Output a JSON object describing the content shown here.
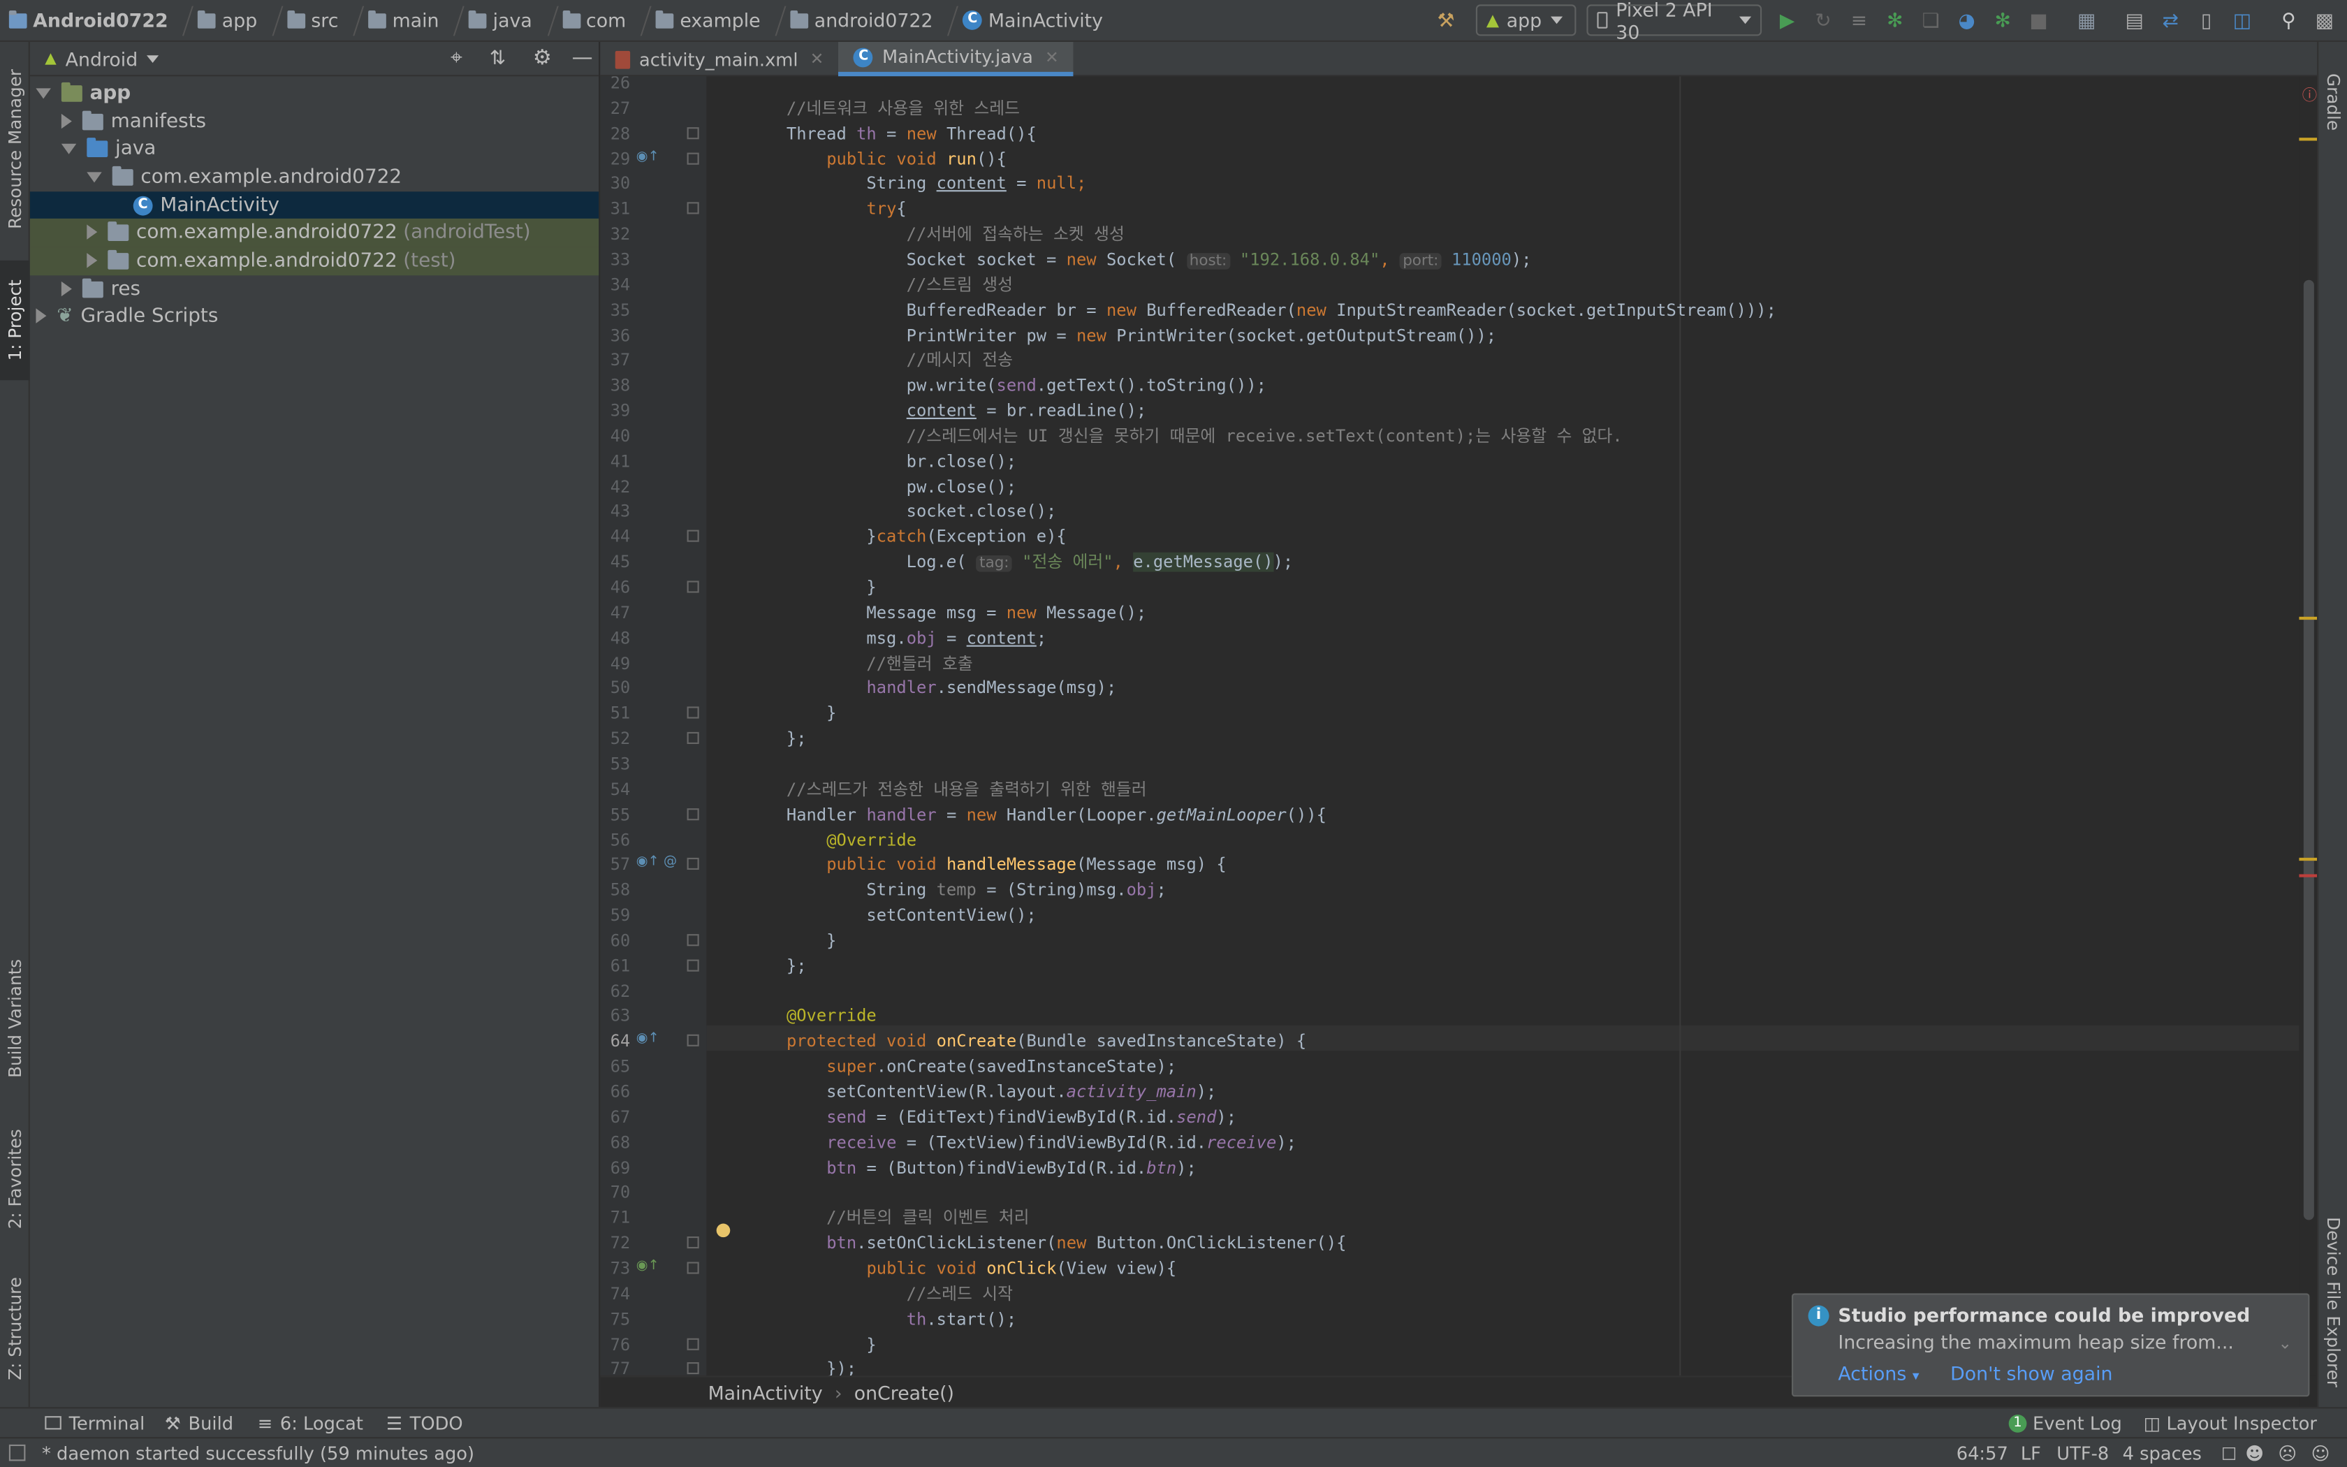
{
  "breadcrumb": {
    "items": [
      "Android0722",
      "app",
      "src",
      "main",
      "java",
      "com",
      "example",
      "android0722"
    ],
    "file": "MainActivity"
  },
  "toolbar": {
    "config": "app",
    "device": "Pixel 2 API 30"
  },
  "left_stripe": {
    "tabs": [
      "Resource Manager",
      "1: Project",
      "Build Variants",
      "2: Favorites",
      "Z: Structure"
    ]
  },
  "right_stripe": {
    "tabs": [
      "Gradle",
      "Device File Explorer"
    ]
  },
  "project_panel": {
    "view": "Android",
    "tree": [
      {
        "label": "app",
        "extra": ""
      },
      {
        "label": "manifests",
        "extra": ""
      },
      {
        "label": "java",
        "extra": ""
      },
      {
        "label": "com.example.android0722",
        "extra": ""
      },
      {
        "label": "MainActivity",
        "extra": ""
      },
      {
        "label": "com.example.android0722",
        "extra": "(androidTest)"
      },
      {
        "label": "com.example.android0722",
        "extra": "(test)"
      },
      {
        "label": "res",
        "extra": ""
      },
      {
        "label": "Gradle Scripts",
        "extra": ""
      }
    ]
  },
  "editor": {
    "tabs": [
      "activity_main.xml",
      "MainActivity.java"
    ],
    "line_numbers": [
      "26",
      "27",
      "28",
      "29",
      "30",
      "31",
      "32",
      "33",
      "34",
      "35",
      "36",
      "37",
      "38",
      "39",
      "40",
      "41",
      "42",
      "43",
      "44",
      "45",
      "46",
      "47",
      "48",
      "49",
      "50",
      "51",
      "52",
      "53",
      "54",
      "55",
      "56",
      "57",
      "58",
      "59",
      "60",
      "61",
      "62",
      "63",
      "64",
      "65",
      "66",
      "67",
      "68",
      "69",
      "70",
      "71",
      "72",
      "73",
      "74",
      "75",
      "76",
      "77"
    ],
    "lines": [
      [],
      [
        {
          "t": "        //네트워크 사용을 위한 스레드",
          "c": "cm"
        }
      ],
      [
        {
          "t": "        Thread "
        },
        {
          "t": "th",
          "c": "fld"
        },
        {
          "t": " = "
        },
        {
          "t": "new",
          "c": "kw"
        },
        {
          "t": " Thread(){"
        }
      ],
      [
        {
          "t": "            "
        },
        {
          "t": "public void",
          "c": "kw"
        },
        {
          "t": " "
        },
        {
          "t": "run",
          "c": "mth"
        },
        {
          "t": "(){"
        }
      ],
      [
        {
          "t": "                String "
        },
        {
          "t": "content",
          "c": "ul"
        },
        {
          "t": " = "
        },
        {
          "t": "null",
          "c": "kw"
        },
        {
          "t": ";",
          "c": "kw"
        }
      ],
      [
        {
          "t": "                "
        },
        {
          "t": "try",
          "c": "kw"
        },
        {
          "t": "{"
        }
      ],
      [
        {
          "t": "                    //서버에 접속하는 소켓 생성",
          "c": "cm"
        }
      ],
      [
        {
          "t": "                    Socket socket = "
        },
        {
          "t": "new",
          "c": "kw"
        },
        {
          "t": " Socket( "
        },
        {
          "t": "host:",
          "c": "hint"
        },
        {
          "t": " "
        },
        {
          "t": "\"192.168.0.84\"",
          "c": "str"
        },
        {
          "t": ", ",
          "c": "kw"
        },
        {
          "t": "port:",
          "c": "hint"
        },
        {
          "t": " "
        },
        {
          "t": "110000",
          "c": "num"
        },
        {
          "t": ");"
        }
      ],
      [
        {
          "t": "                    //스트림 생성",
          "c": "cm"
        }
      ],
      [
        {
          "t": "                    BufferedReader br = "
        },
        {
          "t": "new",
          "c": "kw"
        },
        {
          "t": " BufferedReader("
        },
        {
          "t": "new",
          "c": "kw"
        },
        {
          "t": " InputStreamReader(socket.getInputStream()));"
        }
      ],
      [
        {
          "t": "                    PrintWriter pw = "
        },
        {
          "t": "new",
          "c": "kw"
        },
        {
          "t": " PrintWriter(socket.getOutputStream());"
        }
      ],
      [
        {
          "t": "                    //메시지 전송",
          "c": "cm"
        }
      ],
      [
        {
          "t": "                    pw.write("
        },
        {
          "t": "send",
          "c": "fld"
        },
        {
          "t": ".getText().toString());"
        }
      ],
      [
        {
          "t": "                    "
        },
        {
          "t": "content",
          "c": "ul"
        },
        {
          "t": " = br.readLine();"
        }
      ],
      [
        {
          "t": "                    //스레드에서는 UI 갱신을 못하기 때문에 receive.setText(content);는 사용할 수 없다.",
          "c": "cm"
        }
      ],
      [
        {
          "t": "                    br.close();"
        }
      ],
      [
        {
          "t": "                    pw.close();"
        }
      ],
      [
        {
          "t": "                    socket.close();"
        }
      ],
      [
        {
          "t": "                }"
        },
        {
          "t": "catch",
          "c": "kw"
        },
        {
          "t": "(Exception e){"
        }
      ],
      [
        {
          "t": "                    Log."
        },
        {
          "t": "e",
          "c": "it"
        },
        {
          "t": "( "
        },
        {
          "t": "tag:",
          "c": "hint"
        },
        {
          "t": " "
        },
        {
          "t": "\"전송 에러\"",
          "c": "str"
        },
        {
          "t": ", ",
          "c": "kw"
        },
        {
          "t": "e.getMessage()",
          "c": "hl"
        },
        {
          "t": ");"
        }
      ],
      [
        {
          "t": "                }"
        }
      ],
      [
        {
          "t": "                Message msg = "
        },
        {
          "t": "new",
          "c": "kw"
        },
        {
          "t": " Message();"
        }
      ],
      [
        {
          "t": "                msg."
        },
        {
          "t": "obj",
          "c": "fld"
        },
        {
          "t": " = "
        },
        {
          "t": "content",
          "c": "ul"
        },
        {
          "t": ";"
        }
      ],
      [
        {
          "t": "                //핸들러 호출",
          "c": "cm"
        }
      ],
      [
        {
          "t": "                "
        },
        {
          "t": "handler",
          "c": "fld"
        },
        {
          "t": ".sendMessage(msg);"
        }
      ],
      [
        {
          "t": "            }"
        }
      ],
      [
        {
          "t": "        };"
        }
      ],
      [],
      [
        {
          "t": "        //스레드가 전송한 내용을 출력하기 위한 핸들러",
          "c": "cm"
        }
      ],
      [
        {
          "t": "        Handler "
        },
        {
          "t": "handler",
          "c": "fld"
        },
        {
          "t": " = "
        },
        {
          "t": "new",
          "c": "kw"
        },
        {
          "t": " Handler(Looper."
        },
        {
          "t": "getMainLooper",
          "c": "it"
        },
        {
          "t": "()){"
        }
      ],
      [
        {
          "t": "            "
        },
        {
          "t": "@Override",
          "c": "ann"
        }
      ],
      [
        {
          "t": "            "
        },
        {
          "t": "public void",
          "c": "kw"
        },
        {
          "t": " "
        },
        {
          "t": "handleMessage",
          "c": "mth"
        },
        {
          "t": "(Message msg) {"
        }
      ],
      [
        {
          "t": "                String "
        },
        {
          "t": "temp",
          "c": "cm"
        },
        {
          "t": " = (String)msg."
        },
        {
          "t": "obj",
          "c": "fld"
        },
        {
          "t": ";"
        }
      ],
      [
        {
          "t": "                setContentView();"
        }
      ],
      [
        {
          "t": "            }"
        }
      ],
      [
        {
          "t": "        };"
        }
      ],
      [],
      [
        {
          "t": "        "
        },
        {
          "t": "@Override",
          "c": "ann"
        }
      ],
      [
        {
          "t": "        "
        },
        {
          "t": "protected void",
          "c": "kw"
        },
        {
          "t": " "
        },
        {
          "t": "onCreate",
          "c": "mth"
        },
        {
          "t": "(Bundle savedInstanceState) {"
        }
      ],
      [
        {
          "t": "            "
        },
        {
          "t": "super",
          "c": "kw"
        },
        {
          "t": ".onCreate(savedInstanceState);"
        }
      ],
      [
        {
          "t": "            setContentView(R.layout."
        },
        {
          "t": "activity_main",
          "c": "fld it"
        },
        {
          "t": ");"
        }
      ],
      [
        {
          "t": "            "
        },
        {
          "t": "send",
          "c": "fld"
        },
        {
          "t": " = (EditText)findViewById(R.id."
        },
        {
          "t": "send",
          "c": "fld it"
        },
        {
          "t": ");"
        }
      ],
      [
        {
          "t": "            "
        },
        {
          "t": "receive",
          "c": "fld"
        },
        {
          "t": " = (TextView)findViewById(R.id."
        },
        {
          "t": "receive",
          "c": "fld it"
        },
        {
          "t": ");"
        }
      ],
      [
        {
          "t": "            "
        },
        {
          "t": "btn",
          "c": "fld"
        },
        {
          "t": " = (Button)findViewById(R.id."
        },
        {
          "t": "btn",
          "c": "fld it"
        },
        {
          "t": ");"
        }
      ],
      [],
      [
        {
          "t": "            //버튼의 클릭 이벤트 처리",
          "c": "cm"
        }
      ],
      [
        {
          "t": "            "
        },
        {
          "t": "btn",
          "c": "fld"
        },
        {
          "t": ".setOnClickListener("
        },
        {
          "t": "new",
          "c": "kw"
        },
        {
          "t": " Button.OnClickListener(){"
        }
      ],
      [
        {
          "t": "                "
        },
        {
          "t": "public void",
          "c": "kw"
        },
        {
          "t": " "
        },
        {
          "t": "onClick",
          "c": "mth"
        },
        {
          "t": "(View view){"
        }
      ],
      [
        {
          "t": "                    //스레드 시작",
          "c": "cm"
        }
      ],
      [
        {
          "t": "                    "
        },
        {
          "t": "th",
          "c": "fld"
        },
        {
          "t": ".start();"
        }
      ],
      [
        {
          "t": "                }"
        }
      ],
      [
        {
          "t": "            });"
        }
      ]
    ]
  },
  "editor_breadcrumb": [
    "MainActivity",
    "onCreate()"
  ],
  "notification": {
    "title": "Studio performance could be improved",
    "body": "Increasing the maximum heap size from...",
    "actions": "Actions",
    "dismiss": "Don't show again"
  },
  "tool_windows": {
    "terminal": "Terminal",
    "build": "Build",
    "logcat": "6: Logcat",
    "todo": "TODO",
    "event_log": "Event Log",
    "event_log_count": "1",
    "layout_inspector": "Layout Inspector"
  },
  "status": {
    "message": "* daemon started successfully (59 minutes ago)",
    "position": "64:57",
    "line_sep": "LF",
    "encoding": "UTF-8",
    "indent": "4 spaces"
  },
  "colors": {
    "accent": "#4a88c7",
    "keyword": "#cc7832",
    "string": "#6a8759",
    "run_green": "#499c54"
  }
}
